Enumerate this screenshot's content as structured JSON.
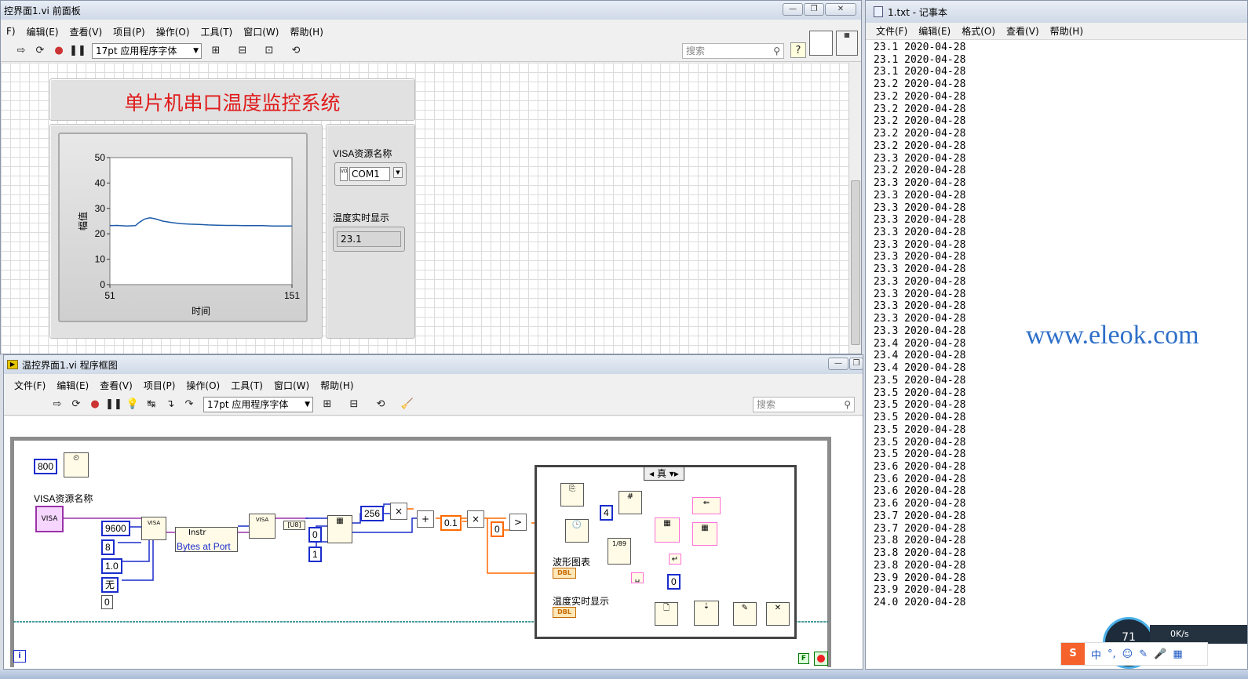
{
  "front_panel": {
    "title": "控界面1.vi 前面板",
    "menus": [
      "F)",
      "编辑(E)",
      "查看(V)",
      "项目(P)",
      "操作(O)",
      "工具(T)",
      "窗口(W)",
      "帮助(H)"
    ],
    "font": "17pt 应用程序字体",
    "search_placeholder": "搜索",
    "system_title": "单片机串口温度监控系统",
    "visa_label": "VISA资源名称",
    "visa_value": "COM1",
    "visa_prefix": "I/O",
    "temp_label": "温度实时显示",
    "temp_value": "23.1"
  },
  "chart_data": {
    "type": "line",
    "xlabel": "时间",
    "ylabel": "幅值",
    "xlim": [
      51,
      151
    ],
    "ylim": [
      0,
      50
    ],
    "x_ticks": [
      "51",
      "151"
    ],
    "y_ticks": [
      "0",
      "10",
      "20",
      "30",
      "40",
      "50"
    ],
    "series": [
      {
        "color": "#1c5ba8",
        "x": [
          51,
          55,
          60,
          65,
          67,
          70,
          73,
          76,
          80,
          85,
          90,
          95,
          100,
          105,
          110,
          115,
          120,
          125,
          130,
          135,
          140,
          145,
          151
        ],
        "y": [
          23.2,
          23.3,
          23.1,
          23.2,
          24.4,
          25.8,
          26.3,
          25.9,
          25.0,
          24.4,
          24.0,
          23.8,
          23.7,
          23.5,
          23.4,
          23.3,
          23.3,
          23.2,
          23.2,
          23.2,
          23.1,
          23.1,
          23.1
        ]
      }
    ]
  },
  "block_diagram": {
    "title": "温控界面1.vi 程序框图",
    "menus": [
      "文件(F)",
      "编辑(E)",
      "查看(V)",
      "项目(P)",
      "操作(O)",
      "工具(T)",
      "窗口(W)",
      "帮助(H)"
    ],
    "font": "17pt 应用程序字体",
    "search_placeholder": "搜索",
    "wait_ms": "800",
    "visa_label": "VISA资源名称",
    "baud": "9600",
    "data_bits": "8",
    "stop_bits": "1.0",
    "parity": "无",
    "flow": "0",
    "instr": "Instr",
    "bytes_at_port": "Bytes at Port",
    "u8": "[U8]",
    "index0": "0",
    "index1": "1",
    "mult_const": "256",
    "scale_const": "0.1",
    "zero_const": "0",
    "case_label": "真",
    "precision": "4",
    "zero2": "0",
    "chart_label": "波形图表",
    "temp_label": "温度实时显示",
    "dbl": "DBL",
    "loop_f": "F"
  },
  "notepad": {
    "title": "1.txt - 记事本",
    "menus": [
      "文件(F)",
      "编辑(E)",
      "格式(O)",
      "查看(V)",
      "帮助(H)"
    ],
    "lines": [
      "23.1 2020-04-28",
      "23.1 2020-04-28",
      "23.1 2020-04-28",
      "23.2 2020-04-28",
      "23.2 2020-04-28",
      "23.2 2020-04-28",
      "23.2 2020-04-28",
      "23.2 2020-04-28",
      "23.2 2020-04-28",
      "23.3 2020-04-28",
      "23.2 2020-04-28",
      "23.3 2020-04-28",
      "23.3 2020-04-28",
      "23.3 2020-04-28",
      "23.3 2020-04-28",
      "23.3 2020-04-28",
      "23.3 2020-04-28",
      "23.3 2020-04-28",
      "23.3 2020-04-28",
      "23.3 2020-04-28",
      "23.3 2020-04-28",
      "23.3 2020-04-28",
      "23.3 2020-04-28",
      "23.3 2020-04-28",
      "23.4 2020-04-28",
      "23.4 2020-04-28",
      "23.4 2020-04-28",
      "23.5 2020-04-28",
      "23.5 2020-04-28",
      "23.5 2020-04-28",
      "23.5 2020-04-28",
      "23.5 2020-04-28",
      "23.5 2020-04-28",
      "23.5 2020-04-28",
      "23.6 2020-04-28",
      "23.6 2020-04-28",
      "23.6 2020-04-28",
      "23.6 2020-04-28",
      "23.7 2020-04-28",
      "23.7 2020-04-28",
      "23.8 2020-04-28",
      "23.8 2020-04-28",
      "23.8 2020-04-28",
      "23.9 2020-04-28",
      "23.9 2020-04-28",
      "24.0 2020-04-28"
    ],
    "watermark": "www.eleok.com"
  },
  "widget": {
    "speed": "0K/s",
    "percent": "71",
    "ime": "中"
  }
}
